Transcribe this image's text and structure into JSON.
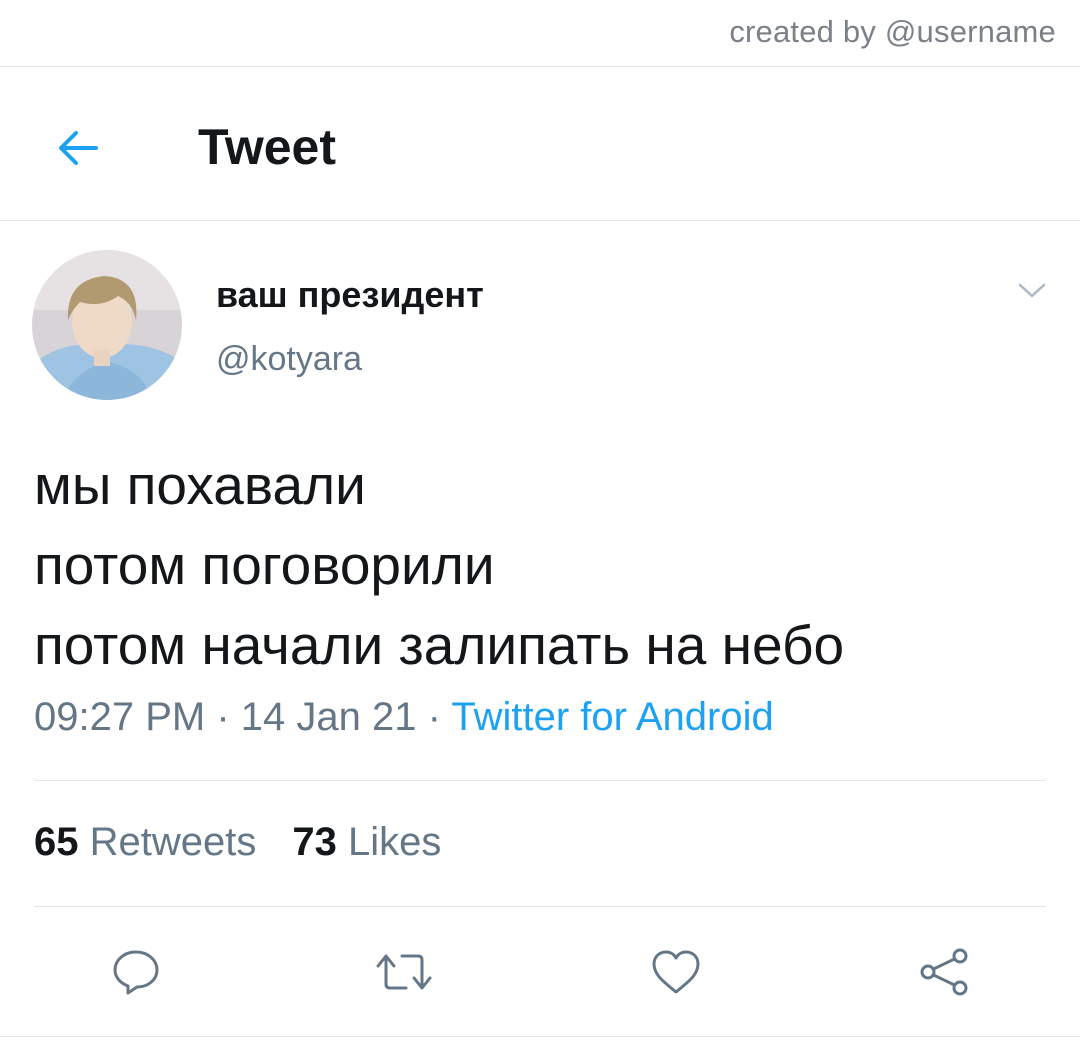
{
  "watermark": "created by @username",
  "header": {
    "title": "Tweet",
    "back_icon": "arrow-left-icon"
  },
  "tweet": {
    "display_name": "ваш президент",
    "handle": "@kotyara",
    "text_lines": [
      "мы похавали",
      "потом поговорили",
      "потом начали залипать на небо"
    ],
    "time": "09:27 PM",
    "date": "14 Jan 21",
    "separator": "·",
    "source": "Twitter for Android"
  },
  "stats": {
    "retweets_count": "65",
    "retweets_label": "Retweets",
    "likes_count": "73",
    "likes_label": "Likes"
  },
  "actions": [
    "reply-icon",
    "retweet-icon",
    "like-icon",
    "share-icon"
  ],
  "colors": {
    "accent": "#1da1f2",
    "text_primary": "#14171a",
    "text_secondary": "#657786",
    "divider": "#e1e8ed"
  }
}
